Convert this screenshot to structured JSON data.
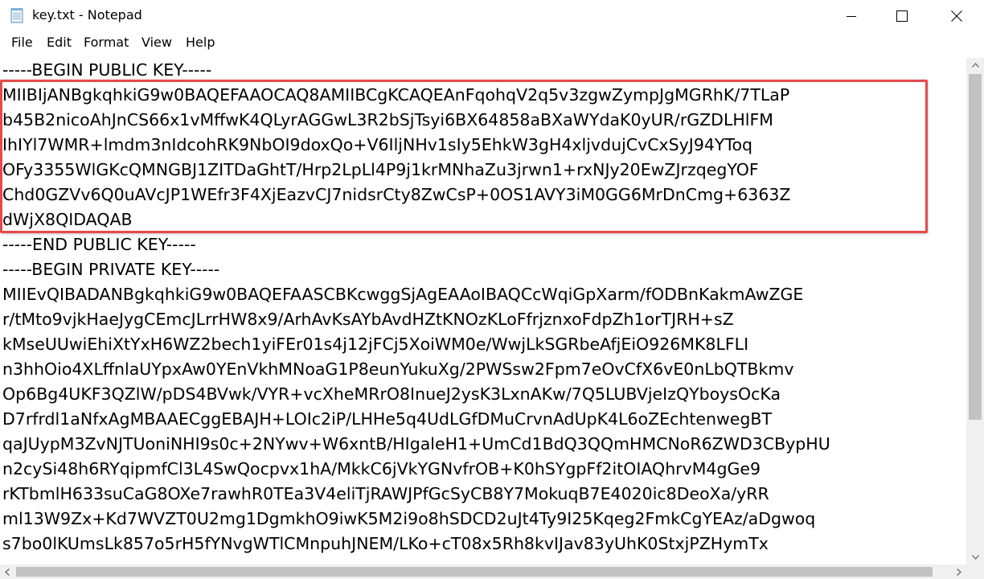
{
  "window": {
    "file_name": "key.txt",
    "separator": " - ",
    "app_name": "Notepad",
    "icon": "notepad-icon",
    "controls": [
      "minimize-icon",
      "maximize-icon",
      "close-icon"
    ]
  },
  "menu": {
    "items": [
      "File",
      "Edit",
      "Format",
      "View",
      "Help"
    ]
  },
  "editor": {
    "highlight_color": "#e84848",
    "lines": [
      "-----BEGIN PUBLIC KEY-----",
      "MIIBIjANBgkqhkiG9w0BAQEFAAOCAQ8AMIIBCgKCAQEAnFqohqV2q5v3zgwZympJgMGRhK/7TLaP",
      "b45B2nicoAhJnCS66x1vMffwK4QLyrAGGwL3R2bSjTsyi6BX64858aBXaWYdaK0yUR/rGZDLHlFM",
      "IhIYl7WMR+lmdm3nIdcohRK9NbOI9doxQo+V6IljNHv1sIy5EhkW3gH4xljvdujCvCxSyJ94YToq",
      "OFy3355WlGKcQMNGBJ1ZITDaGhtT/Hrp2LpLl4P9j1krMNhaZu3jrwn1+rxNJy20EwZJrzqegYOF",
      "Chd0GZVv6Q0uAVcJP1WEfr3F4XjEazvCJ7nidsrCty8ZwCsP+0OS1AVY3iM0GG6MrDnCmg+6363Z",
      "dWjX8QIDAQAB",
      "-----END PUBLIC KEY-----",
      "-----BEGIN PRIVATE KEY-----",
      "MIIEvQIBADANBgkqhkiG9w0BAQEFAASCBKcwggSjAgEAAoIBAQCcWqiGpXarm/fODBnKakmAwZGE",
      "r/tMto9vjkHaeJygCEmcJLrrHW8x9/ArhAvKsAYbAvdHZtKNOzKLoFfrjznxoFdpZh1orTJRH+sZ",
      "kMseUUwiEhiXtYxH6WZ2bech1yiFEr01s4j12jFCj5XoiWM0e/WwjLkSGRbeAfjEiO926MK8LFLI",
      "n3hhOio4XLffnlaUYpxAw0YEnVkhMNoaG1P8eunYukuXg/2PWSsw2Fpm7eOvCfX6vE0nLbQTBkmv",
      "Op6Bg4UKF3QZlW/pDS4BVwk/VYR+vcXheMRrO8InueJ2ysK3LxnAKw/7Q5LUBVjeIzQYboysOcKa",
      "D7rfrdl1aNfxAgMBAAECggEBAJH+LOIc2iP/LHHe5q4UdLGfDMuCrvnAdUpK4L6oZEchtenwegBT",
      "qaJUypM3ZvNJTUoniNHI9s0c+2NYwv+W6xntB/HIgaleH1+UmCd1BdQ3QQmHMCNoR6ZWD3CBypHU",
      "n2cySi48h6RYqipmfCl3L4SwQocpvx1hA/MkkC6jVkYGNvfrOB+K0hSYgpFf2itOIAQhrvM4gGe9",
      "rKTbmlH633suCaG8OXe7rawhR0TEa3V4eliTjRAWJPfGcSyCB8Y7MokuqB7E4020ic8DeoXa/yRR",
      "ml13W9Zx+Kd7WVZT0U2mg1DgmkhO9iwK5M2i9o8hSDCD2uJt4Ty9I25Kqeg2FmkCgYEAz/aDgwoq",
      "s7bo0lKUmsLk857o5rH5fYNvgWTlCMnpuhJNEM/LKo+cT08x5Rh8kvIJav83yUhK0StxjPZHymTx"
    ]
  }
}
